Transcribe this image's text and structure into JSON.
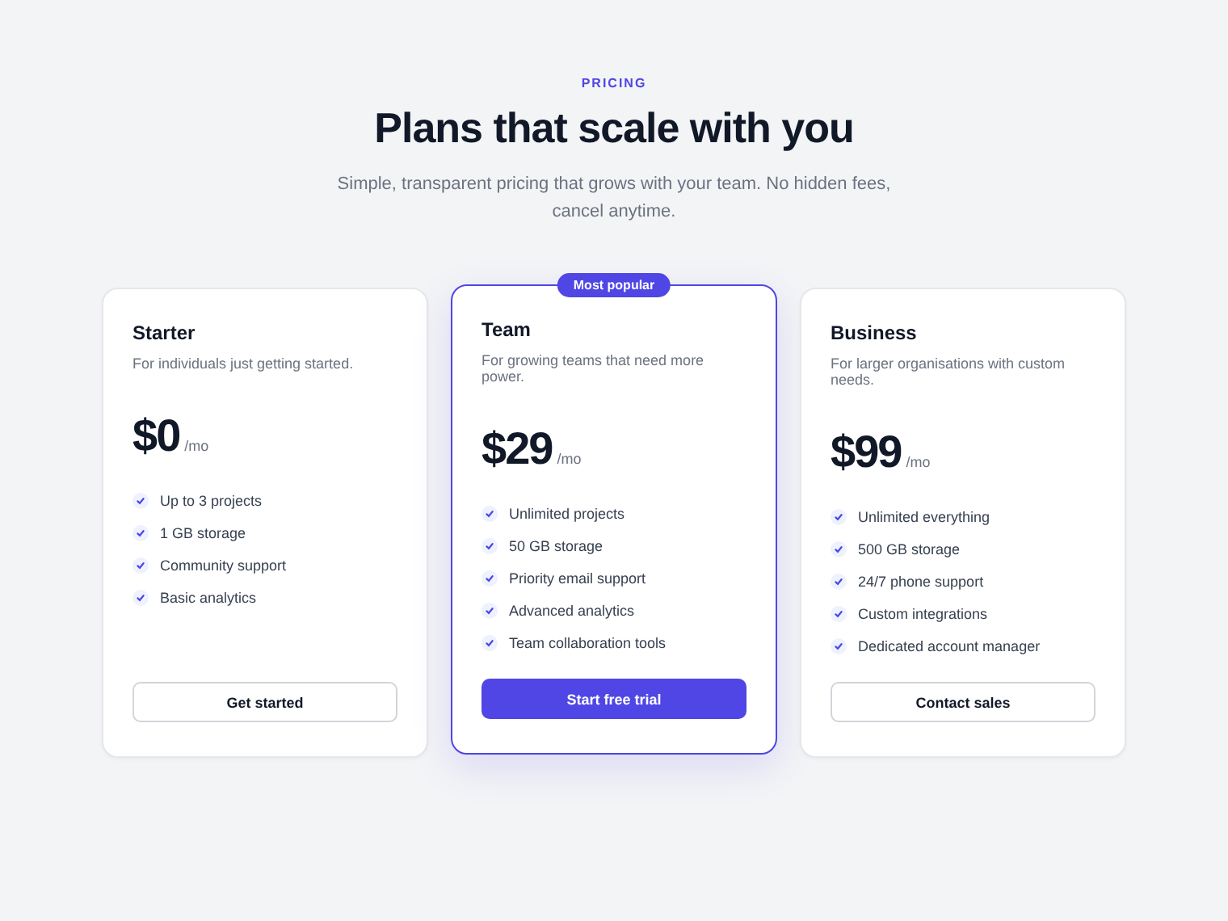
{
  "header": {
    "eyebrow": "PRICING",
    "title": "Plans that scale with you",
    "subtitle": "Simple, transparent pricing that grows with your team. No hidden fees, cancel anytime."
  },
  "plans": [
    {
      "name": "Starter",
      "description": "For individuals just getting started.",
      "price": "$0",
      "period": "/mo",
      "featured": false,
      "features": [
        "Up to 3 projects",
        "1 GB storage",
        "Community support",
        "Basic analytics"
      ],
      "cta": "Get started"
    },
    {
      "name": "Team",
      "description": "For growing teams that need more power.",
      "price": "$29",
      "period": "/mo",
      "featured": true,
      "badge": "Most popular",
      "features": [
        "Unlimited projects",
        "50 GB storage",
        "Priority email support",
        "Advanced analytics",
        "Team collaboration tools"
      ],
      "cta": "Start free trial"
    },
    {
      "name": "Business",
      "description": "For larger organisations with custom needs.",
      "price": "$99",
      "period": "/mo",
      "featured": false,
      "features": [
        "Unlimited everything",
        "500 GB storage",
        "24/7 phone support",
        "Custom integrations",
        "Dedicated account manager"
      ],
      "cta": "Contact sales"
    }
  ]
}
